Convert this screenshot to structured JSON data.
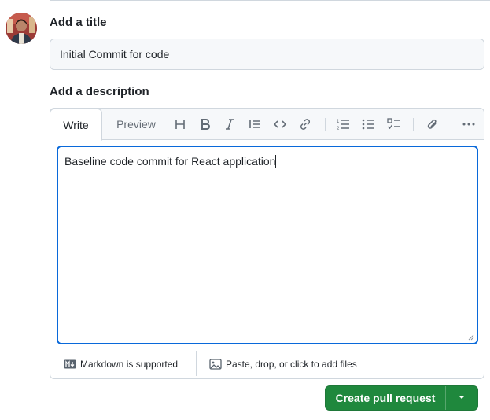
{
  "title_section": {
    "label": "Add a title",
    "value": "Initial Commit for code"
  },
  "description_section": {
    "label": "Add a description",
    "tabs": [
      {
        "label": "Write",
        "active": true
      },
      {
        "label": "Preview",
        "active": false
      }
    ],
    "toolbar_icons": [
      "heading-icon",
      "bold-icon",
      "italic-icon",
      "quote-icon",
      "code-icon",
      "link-icon",
      "ordered-list-icon",
      "unordered-list-icon",
      "task-list-icon",
      "attach-icon",
      "more-icon"
    ],
    "body": "Baseline code commit for React application"
  },
  "footer": {
    "markdown_label": "Markdown is supported",
    "attach_label": "Paste, drop, or click to add files"
  },
  "submit": {
    "label": "Create pull request"
  },
  "colors": {
    "primary_green": "#1f883d",
    "focus_blue": "#0969da",
    "border": "#d0d7de",
    "muted_bg": "#f6f8fa"
  }
}
